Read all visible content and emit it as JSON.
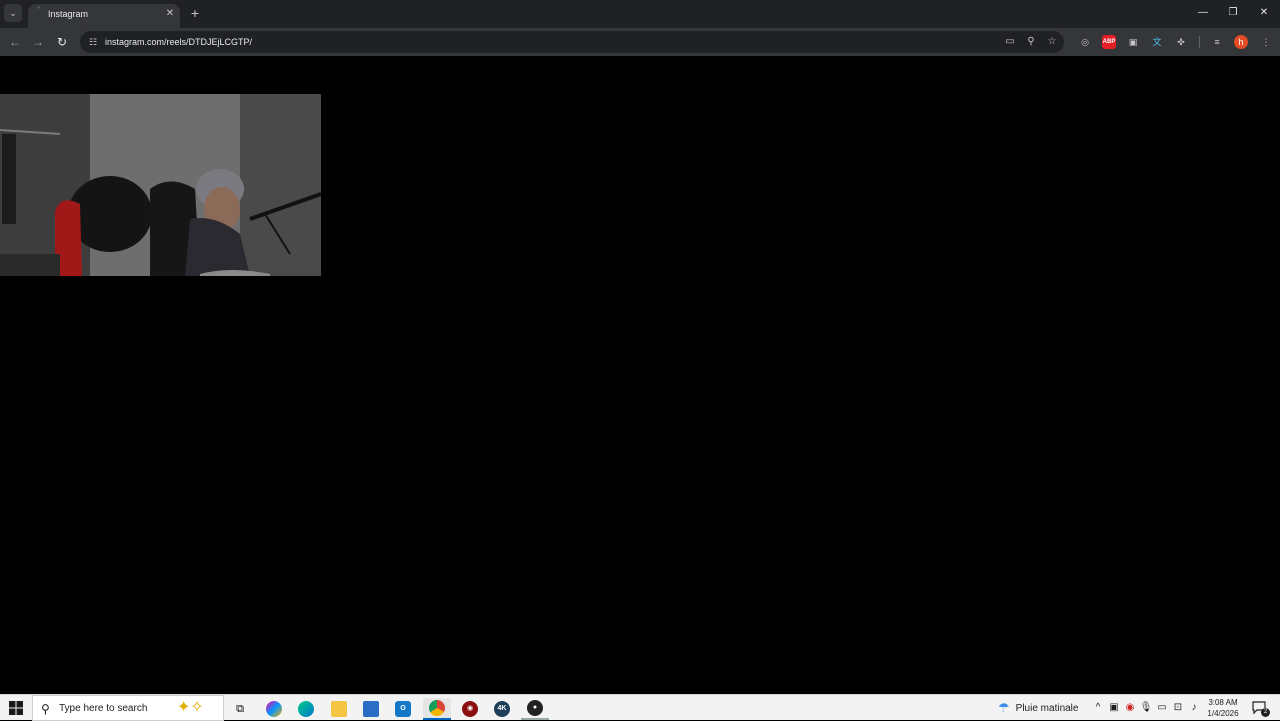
{
  "browser": {
    "tab": {
      "title": "Instagram"
    },
    "url": "instagram.com/reels/DTDJEjLCGTP/"
  },
  "page": {
    "video_thumbnail": {
      "description_icon": "video-frame"
    }
  },
  "taskbar": {
    "search_placeholder": "Type here to search",
    "weather": {
      "text": "Pluie matinale"
    },
    "clock": {
      "time": "3:08 AM",
      "date": "1/4/2026"
    },
    "notification_count": "2"
  },
  "colors": {
    "chrome_dark": "#202124",
    "chrome_toolbar": "#35363a",
    "taskbar": "#f3f3f3",
    "accent": "#0067c0",
    "profile": "#e34c26"
  }
}
